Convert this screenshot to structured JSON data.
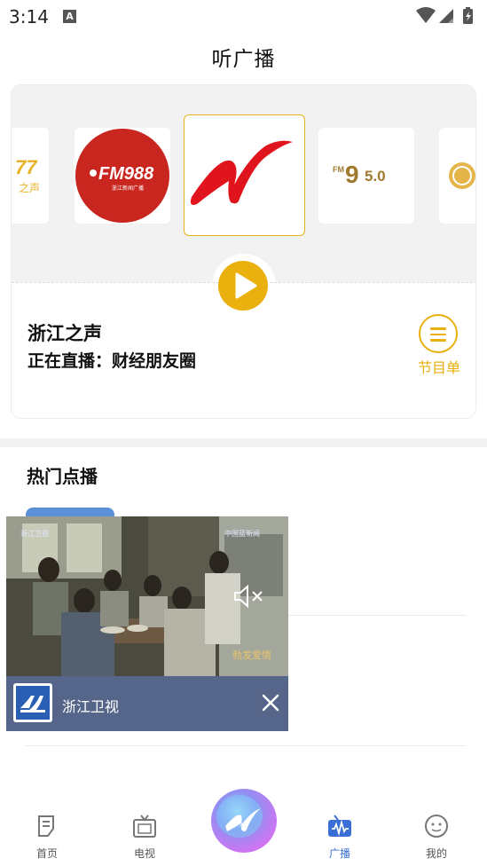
{
  "status_bar": {
    "time": "3:14",
    "notification_icon": "A"
  },
  "header": {
    "title": "听广播"
  },
  "radio": {
    "stations": [
      {
        "name": "partial-station-left",
        "logo_text": "77\n之声"
      },
      {
        "name": "fm988",
        "logo_text": "FM988",
        "logo_sub": "浙江新闻广播"
      },
      {
        "name": "zhejiang-voice",
        "selected": true
      },
      {
        "name": "fm95",
        "logo_text": "FM 95.0"
      },
      {
        "name": "partial-station-right"
      }
    ],
    "current_station": "浙江之声",
    "now_playing": "正在直播：财经朋友圈",
    "schedule_label": "节目单"
  },
  "hot": {
    "title": "热门点播"
  },
  "float_player": {
    "video_caption": "勃发爱情",
    "watermark": "中国蓝新闻",
    "channel_name": "浙江卫视"
  },
  "nav": {
    "items": [
      {
        "label": "首页"
      },
      {
        "label": "电视"
      },
      {
        "label": "广播"
      },
      {
        "label": "我的"
      }
    ],
    "active_index": 2
  },
  "colors": {
    "accent_gold": "#e9b00e",
    "nav_active": "#3a6fd8",
    "fm988_red": "#c8261f",
    "logo_red": "#e0141c",
    "channel_bar": "#56668a"
  }
}
